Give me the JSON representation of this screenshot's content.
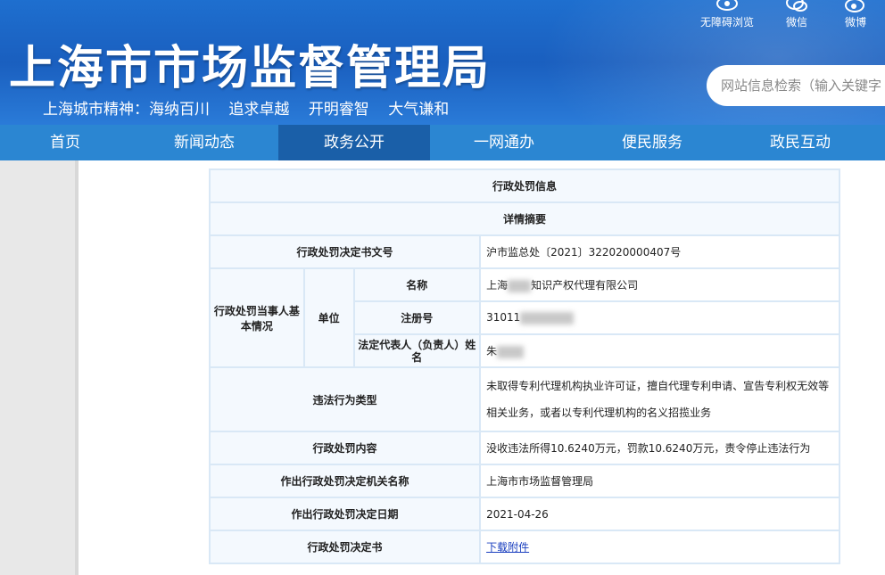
{
  "header": {
    "title": "上海市市场监督管理局",
    "slogan": [
      "上海城市精神：海纳百川",
      "追求卓越",
      "开明睿智",
      "大气谦和"
    ],
    "tools": [
      {
        "label": "无障碍浏览",
        "icon": "eye-icon"
      },
      {
        "label": "微信",
        "icon": "wechat-icon"
      },
      {
        "label": "微博",
        "icon": "weibo-icon"
      }
    ],
    "search_placeholder": "网站信息检索（输入关键字"
  },
  "nav": {
    "items": [
      "首页",
      "新闻动态",
      "政务公开",
      "一网通办",
      "便民服务",
      "政民互动"
    ],
    "active": "政务公开"
  },
  "table": {
    "title": "行政处罚信息",
    "subtitle": "详情摘要",
    "doc_number_label": "行政处罚决定书文号",
    "doc_number": "沪市监总处〔2021〕322020000407号",
    "party_label": "行政处罚当事人基本情况",
    "unit_label": "单位",
    "name_label": "名称",
    "name_prefix": "上海",
    "name_suffix": "知识产权代理有限公司",
    "reg_label": "注册号",
    "reg_prefix": "31011",
    "rep_label": "法定代表人（负责人）姓名",
    "rep_prefix": "朱",
    "violation_label": "违法行为类型",
    "violation": "未取得专利代理机构执业许可证，擅自代理专利申请、宣告专利权无效等相关业务，或者以专利代理机构的名义招揽业务",
    "content_label": "行政处罚内容",
    "content": "没收违法所得10.6240万元，罚款10.6240万元，责令停止违法行为",
    "authority_label": "作出行政处罚决定机关名称",
    "authority": "上海市市场监督管理局",
    "date_label": "作出行政处罚决定日期",
    "date": "2021-04-26",
    "decision_label": "行政处罚决定书",
    "decision_link": "下载附件"
  }
}
